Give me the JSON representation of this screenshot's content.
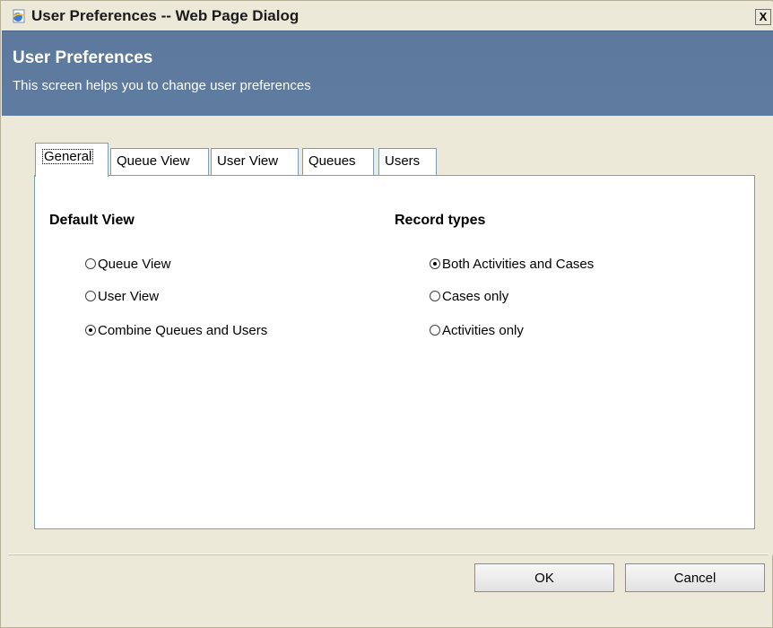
{
  "window": {
    "title": "User Preferences -- Web Page Dialog",
    "close_label": "X"
  },
  "header": {
    "title": "User Preferences",
    "subtitle": "This screen helps you to change user preferences"
  },
  "tabs": [
    {
      "label": "General",
      "active": true
    },
    {
      "label": "Queue View",
      "active": false
    },
    {
      "label": "User View",
      "active": false
    },
    {
      "label": "Queues",
      "active": false
    },
    {
      "label": "Users",
      "active": false
    }
  ],
  "default_view": {
    "title": "Default View",
    "options": [
      {
        "label": "Queue View",
        "checked": false
      },
      {
        "label": "User View",
        "checked": false
      },
      {
        "label": "Combine Queues and Users",
        "checked": true
      }
    ]
  },
  "record_types": {
    "title": "Record types",
    "options": [
      {
        "label": "Both Activities and Cases",
        "checked": true
      },
      {
        "label": "Cases only",
        "checked": false
      },
      {
        "label": "Activities only",
        "checked": false
      }
    ]
  },
  "buttons": {
    "ok": "OK",
    "cancel": "Cancel"
  },
  "colors": {
    "header_bg": "#5d7a9e",
    "chrome_bg": "#ECE9D8",
    "panel_border": "#7f9db9"
  },
  "icons": {
    "app": "ie-page-icon",
    "close": "close-icon"
  }
}
